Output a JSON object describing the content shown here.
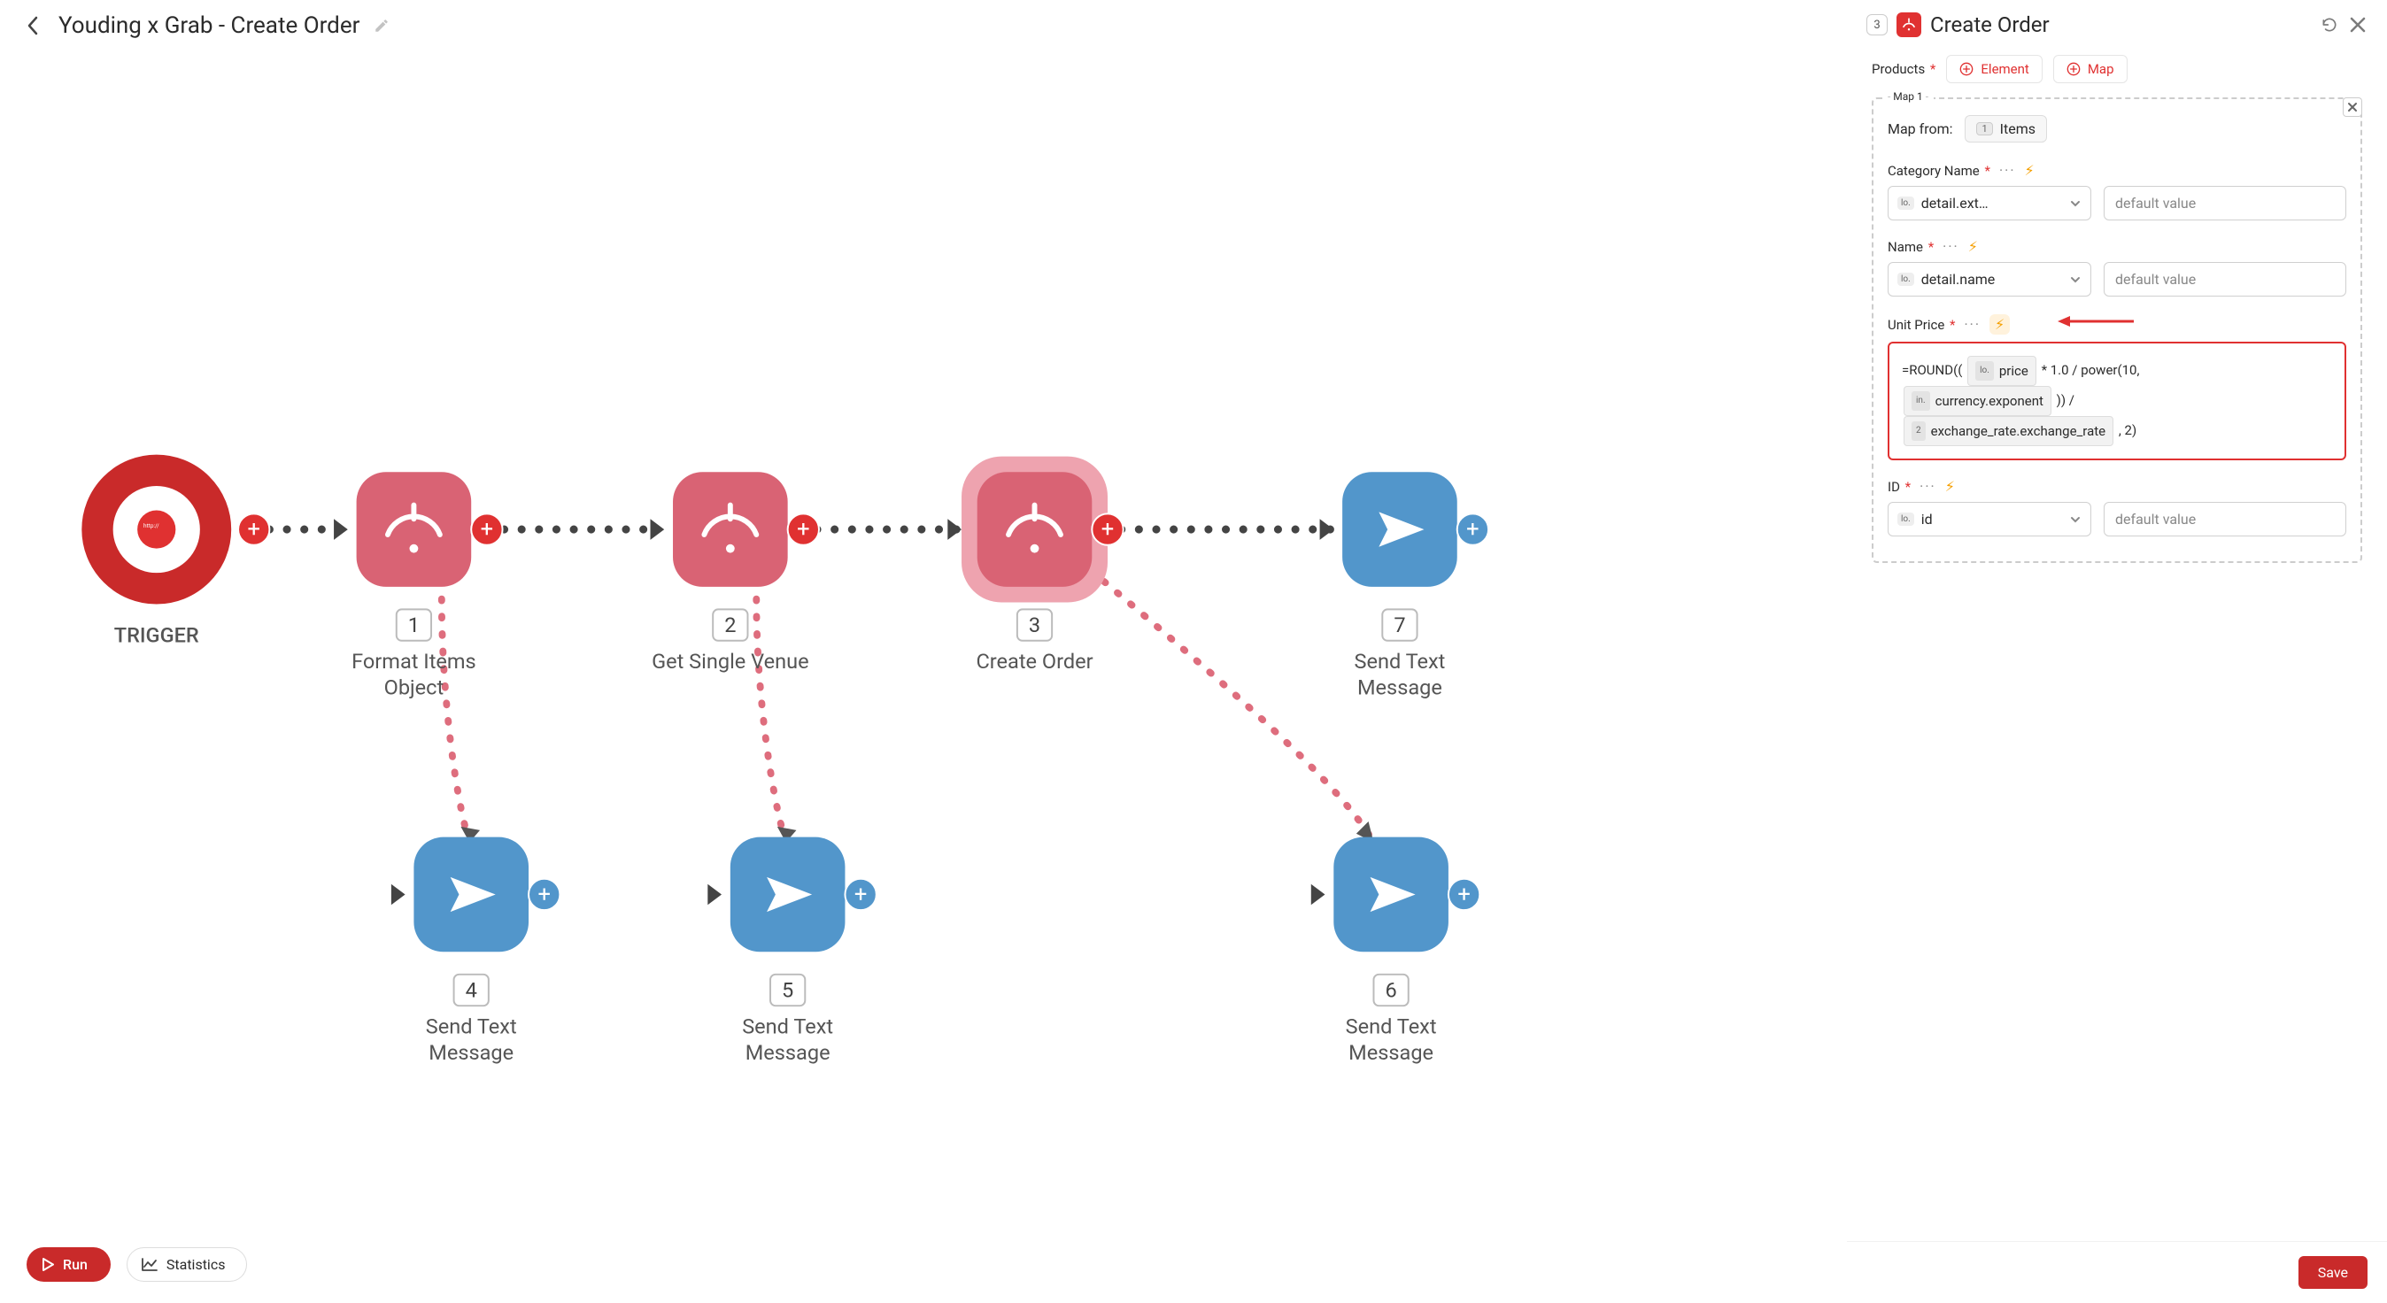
{
  "header": {
    "title": "Youding x Grab - Create Order"
  },
  "footer": {
    "run_label": "Run",
    "stats_label": "Statistics"
  },
  "canvas": {
    "trigger_label": "TRIGGER",
    "nodes": [
      {
        "num": "1",
        "label1": "Format Items",
        "label2": "Object"
      },
      {
        "num": "2",
        "label1": "Get Single Venue",
        "label2": ""
      },
      {
        "num": "3",
        "label1": "Create Order",
        "label2": ""
      },
      {
        "num": "7",
        "label1": "Send Text",
        "label2": "Message"
      },
      {
        "num": "4",
        "label1": "Send Text",
        "label2": "Message"
      },
      {
        "num": "5",
        "label1": "Send Text",
        "label2": "Message"
      },
      {
        "num": "6",
        "label1": "Send Text",
        "label2": "Message"
      }
    ]
  },
  "panel": {
    "node_number": "3",
    "title": "Create Order",
    "products_label": "Products",
    "element_label": "Element",
    "map_label": "Map",
    "map_legend": "Map 1",
    "map_from_label": "Map from:",
    "map_from_pill_num": "1",
    "map_from_pill_label": "Items",
    "fields": {
      "category": {
        "label": "Category Name",
        "prefix": "lo.",
        "value": "detail.ext…",
        "placeholder": "default value"
      },
      "name": {
        "label": "Name",
        "prefix": "lo.",
        "value": "detail.name",
        "placeholder": "default value"
      },
      "unit": {
        "label": "Unit Price"
      },
      "id": {
        "label": "ID",
        "prefix": "lo.",
        "value": "id",
        "placeholder": "default value"
      }
    },
    "formula": {
      "lead": "=ROUND((",
      "chip1_prefix": "lo.",
      "chip1_val": "price",
      "mid1": " * 1.0  / power(10,",
      "chip2_prefix": "in.",
      "chip2_val": "currency.exponent",
      "mid2": " )) /",
      "chip3_prefix": "2",
      "chip3_val": "exchange_rate.exchange_rate",
      "tail": " , 2)"
    },
    "save_label": "Save"
  }
}
